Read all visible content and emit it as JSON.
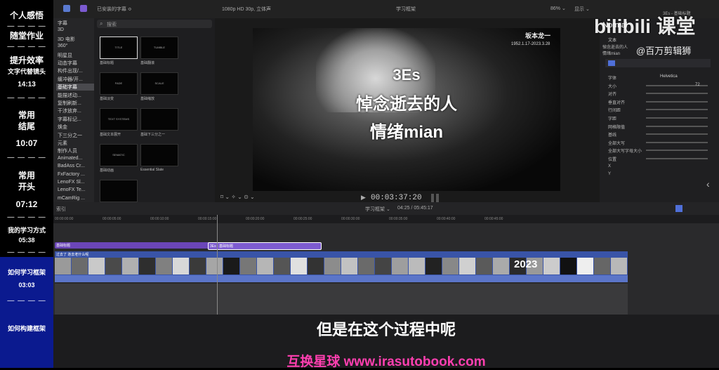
{
  "sidebar": {
    "chapters": [
      {
        "label": "个人感悟"
      },
      {
        "label": "随堂作业"
      },
      {
        "label": "提升效率"
      },
      {
        "label": "文字代替镜头"
      },
      {
        "label": "14:13"
      },
      {
        "label": "常用"
      },
      {
        "label": "结尾"
      },
      {
        "label": "10:07"
      },
      {
        "label": "常用"
      },
      {
        "label": "开头"
      },
      {
        "label": "07:12"
      },
      {
        "label": "我的学习方式"
      },
      {
        "label": "05:38"
      },
      {
        "label": "如何学习框架"
      },
      {
        "label": "03:03"
      },
      {
        "label": "如何构建框架"
      }
    ],
    "divider": "— — — —"
  },
  "topbar": {
    "library_filter": "已安装的字幕 ≎",
    "format": "1080p HD 30p, 立体声",
    "project": "学习框架",
    "zoom": "86% ⌄",
    "view": "显示 ⌄"
  },
  "library": {
    "items": [
      "字幕",
      "3D",
      "3D 电影",
      "360°",
      "明星显",
      "动态字幕",
      "构件出现/...",
      "缓冲器/开...",
      "基础字幕",
      "能描述动...",
      "复制刷新...",
      "干涉放弃...",
      "字幕标记...",
      "焕金",
      "下三分之一",
      "元素",
      "制作人员",
      "Animated...",
      "BadAss Cr...",
      "FxFactory ...",
      "LenoFX Sl...",
      "LenoFX Te...",
      "mCamRig ..."
    ],
    "active_index": 8
  },
  "browser": {
    "search_placeholder": "搜索",
    "thumbs": [
      {
        "inner": "TITLE",
        "label": "基础标题"
      },
      {
        "inner": "TUMBLE",
        "label": "基础翻滚"
      },
      {
        "inner": "FADE",
        "label": "基础淡变"
      },
      {
        "inner": "SCALE",
        "label": "基础缩放"
      },
      {
        "inner": "TEXT SYSTEMS",
        "label": "基础文本展开"
      },
      {
        "inner": "",
        "label": "基础下三分之一"
      },
      {
        "inner": "SEMATIC",
        "label": "基础动画"
      },
      {
        "inner": "",
        "label": "Essential Slate"
      },
      {
        "inner": "",
        "label": ""
      }
    ]
  },
  "viewer": {
    "caption_top": "3Es",
    "caption_mid": "悼念逝去的人",
    "caption_bottom": "情绪mian",
    "name_card": "坂本龙一",
    "dates": "1952.1.17-2023.3.28",
    "timecode": "00:03:37:20",
    "view_controls": "⌑ ⌄  ✧ ⌄  ⊙ ⌄"
  },
  "inspector": {
    "header": "3Es - 基础标题",
    "section": "文本",
    "sub": "悼念逝去的人 情绪mian",
    "rows": [
      "字体",
      "大小",
      "对齐",
      "垂直对齐",
      "行间距",
      "字距",
      "网格限值",
      "基线",
      "全部大写",
      "全部大写字母大小",
      "位置",
      "X",
      "Y"
    ],
    "font_value": "Helvetica",
    "size_value": "72"
  },
  "timeline": {
    "index_label": "索引",
    "project_label": "学习框架 ⌄",
    "duration": "04:25 / 05:45:17",
    "rulers": [
      "00:00:00:00",
      "00:00:05:00",
      "00:00:10:00",
      "00:00:15:00",
      "00:00:20:00",
      "00:00:25:00",
      "00:00:30:00",
      "00:00:35:00",
      "00:00:40:00",
      "00:00:45:00"
    ],
    "title_clip_label": "基础标题",
    "title_clip2_label": "3Es - 基础标题",
    "video_clip_label": "过去了 逝去老什么呢",
    "year_label": "2023"
  },
  "overlay": {
    "bilibili": "bilibili 课堂",
    "uploader": "@百万剪辑狮",
    "normal": "Normal",
    "subtitle": "但是在这个过程中呢",
    "watermark": "互换星球 www.irasutobook.com"
  }
}
